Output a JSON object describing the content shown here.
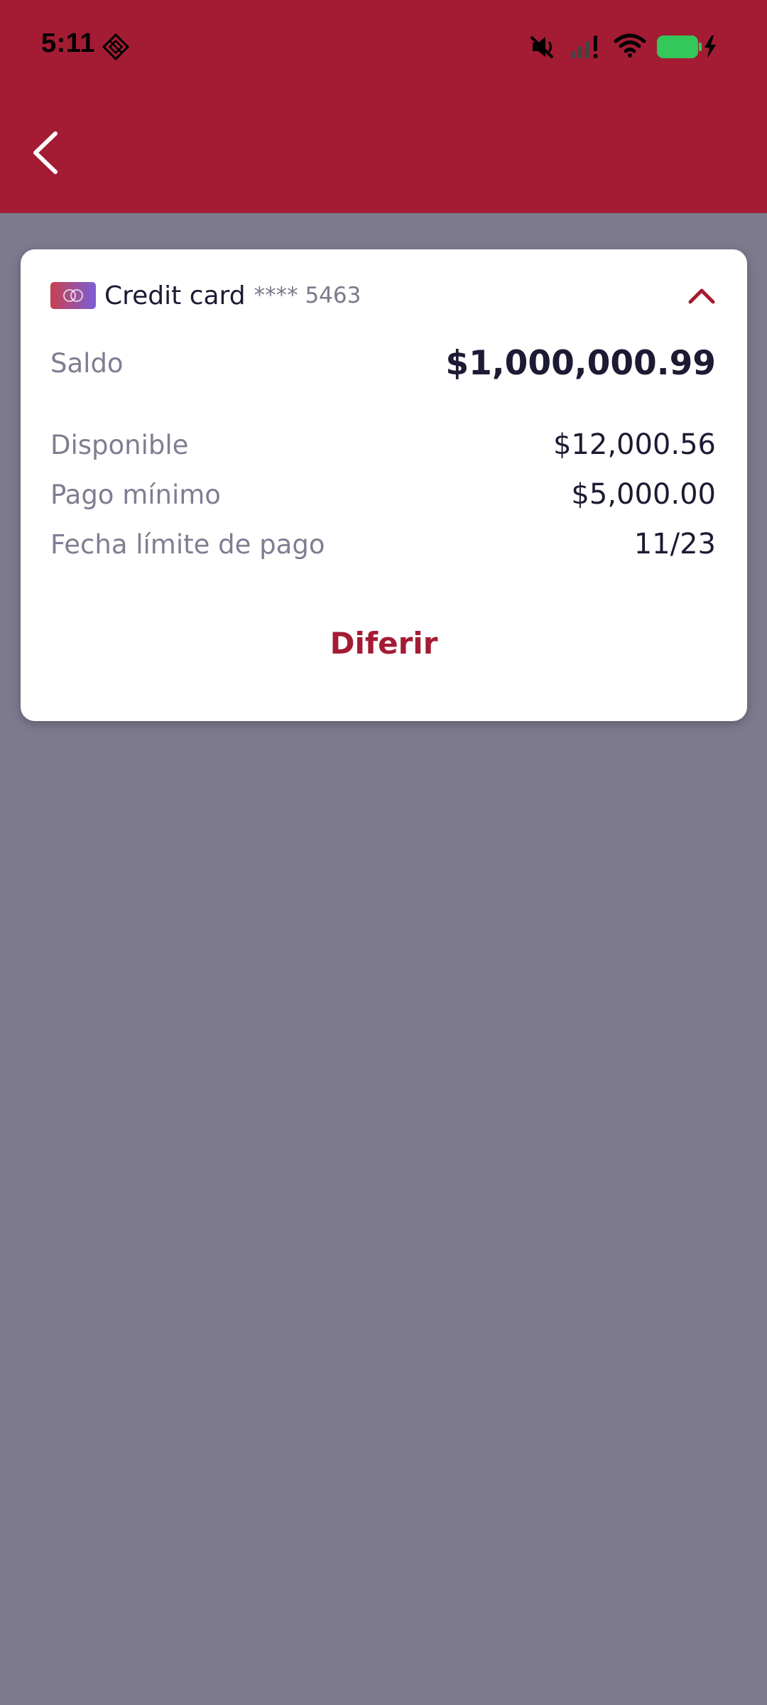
{
  "status_bar": {
    "time": "5:11"
  },
  "header": {
    "background": "#a31c34"
  },
  "card": {
    "name": "Credit card",
    "masked_number": "**** 5463",
    "rows": [
      {
        "label": "Saldo",
        "value": "$1,000,000.99"
      },
      {
        "label": "Disponible",
        "value": "$12,000.56"
      },
      {
        "label": "Pago mínimo",
        "value": "$5,000.00"
      },
      {
        "label": "Fecha límite de pago",
        "value": "11/23"
      }
    ],
    "action_label": "Diferir"
  },
  "colors": {
    "accent": "#a31c34",
    "backdrop": "#7d7a8e",
    "battery": "#34c759"
  },
  "icons": [
    "back-chevron-icon",
    "chevron-up-icon",
    "card-thumbnail-icon",
    "mute-icon",
    "signal-icon",
    "wifi-icon",
    "battery-icon",
    "app-diamond-icon"
  ]
}
